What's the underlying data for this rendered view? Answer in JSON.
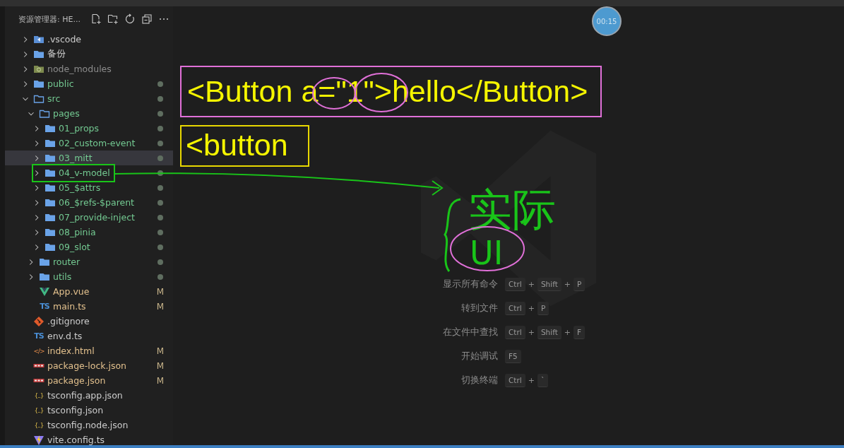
{
  "explorer": {
    "title": "资源管理器: HE...",
    "tree": [
      {
        "name": ".vscode",
        "kind": "vscode-folder",
        "expanded": false,
        "selected": false,
        "untracked": false,
        "ignored": false
      },
      {
        "name": "备份",
        "kind": "folder",
        "expanded": false,
        "selected": false,
        "untracked": false,
        "ignored": false
      },
      {
        "name": "node_modules",
        "kind": "node-folder",
        "expanded": false,
        "selected": false,
        "untracked": false,
        "ignored": true
      },
      {
        "name": "public",
        "kind": "folder",
        "expanded": false,
        "selected": false,
        "untracked": true,
        "ignored": false
      },
      {
        "name": "src",
        "kind": "folder",
        "expanded": true,
        "selected": false,
        "untracked": true,
        "ignored": false,
        "children": [
          {
            "name": "pages",
            "kind": "folder",
            "expanded": true,
            "selected": false,
            "untracked": true,
            "ignored": false,
            "children": [
              {
                "name": "01_props",
                "kind": "folder",
                "expanded": false,
                "selected": false,
                "untracked": true,
                "ignored": false
              },
              {
                "name": "02_custom-event",
                "kind": "folder",
                "expanded": false,
                "selected": false,
                "untracked": true,
                "ignored": false
              },
              {
                "name": "03_mitt",
                "kind": "folder",
                "expanded": false,
                "selected": true,
                "untracked": true,
                "ignored": false
              },
              {
                "name": "04_v-model",
                "kind": "folder",
                "expanded": false,
                "selected": false,
                "untracked": true,
                "ignored": false
              },
              {
                "name": "05_$attrs",
                "kind": "folder",
                "expanded": false,
                "selected": false,
                "untracked": true,
                "ignored": false
              },
              {
                "name": "06_$refs-$parent",
                "kind": "folder",
                "expanded": false,
                "selected": false,
                "untracked": true,
                "ignored": false
              },
              {
                "name": "07_provide-inject",
                "kind": "folder",
                "expanded": false,
                "selected": false,
                "untracked": true,
                "ignored": false
              },
              {
                "name": "08_pinia",
                "kind": "folder",
                "expanded": false,
                "selected": false,
                "untracked": true,
                "ignored": false
              },
              {
                "name": "09_slot",
                "kind": "folder",
                "expanded": false,
                "selected": false,
                "untracked": true,
                "ignored": false
              }
            ]
          },
          {
            "name": "router",
            "kind": "folder",
            "expanded": false,
            "selected": false,
            "untracked": true,
            "ignored": false
          },
          {
            "name": "utils",
            "kind": "folder",
            "expanded": false,
            "selected": false,
            "untracked": true,
            "ignored": false
          },
          {
            "name": "App.vue",
            "kind": "vue",
            "selected": false,
            "ignored": false,
            "badge": "M"
          },
          {
            "name": "main.ts",
            "kind": "ts",
            "icon_label": "TS",
            "selected": false,
            "ignored": false,
            "badge": "M"
          }
        ]
      },
      {
        "name": ".gitignore",
        "kind": "git",
        "selected": false,
        "untracked": false,
        "ignored": false
      },
      {
        "name": "env.d.ts",
        "kind": "ts",
        "icon_label": "TS",
        "selected": false,
        "untracked": false,
        "ignored": false
      },
      {
        "name": "index.html",
        "kind": "html",
        "icon_label": "</>",
        "selected": false,
        "ignored": false,
        "badge": "M"
      },
      {
        "name": "package-lock.json",
        "kind": "npm",
        "selected": false,
        "ignored": false,
        "badge": "M"
      },
      {
        "name": "package.json",
        "kind": "npm",
        "selected": false,
        "ignored": false,
        "badge": "M"
      },
      {
        "name": "tsconfig.app.json",
        "kind": "json",
        "icon_label": "{..}",
        "selected": false,
        "untracked": false,
        "ignored": false
      },
      {
        "name": "tsconfig.json",
        "kind": "json",
        "icon_label": "{..}",
        "selected": false,
        "untracked": false,
        "ignored": false
      },
      {
        "name": "tsconfig.node.json",
        "kind": "json",
        "icon_label": "{..}",
        "selected": false,
        "untracked": false,
        "ignored": false
      },
      {
        "name": "vite.config.ts",
        "kind": "vite",
        "selected": false,
        "untracked": false,
        "ignored": false
      }
    ]
  },
  "editor": {
    "timer": "00:15",
    "shortcuts": [
      {
        "label": "显示所有命令",
        "keys": [
          "Ctrl",
          "+",
          "Shift",
          "+",
          "P"
        ]
      },
      {
        "label": "转到文件",
        "keys": [
          "Ctrl",
          "+",
          "P"
        ]
      },
      {
        "label": "在文件中查找",
        "keys": [
          "Ctrl",
          "+",
          "Shift",
          "+",
          "F"
        ]
      },
      {
        "label": "开始调试",
        "keys": [
          "F5"
        ]
      },
      {
        "label": "切换终端",
        "keys": [
          "Ctrl",
          "+",
          "`"
        ]
      }
    ]
  },
  "annotations": {
    "code_line": "<Button a=\"1\">hello</Button>",
    "code_fragment": "<button",
    "handwriting": [
      "实际",
      "UI"
    ]
  }
}
